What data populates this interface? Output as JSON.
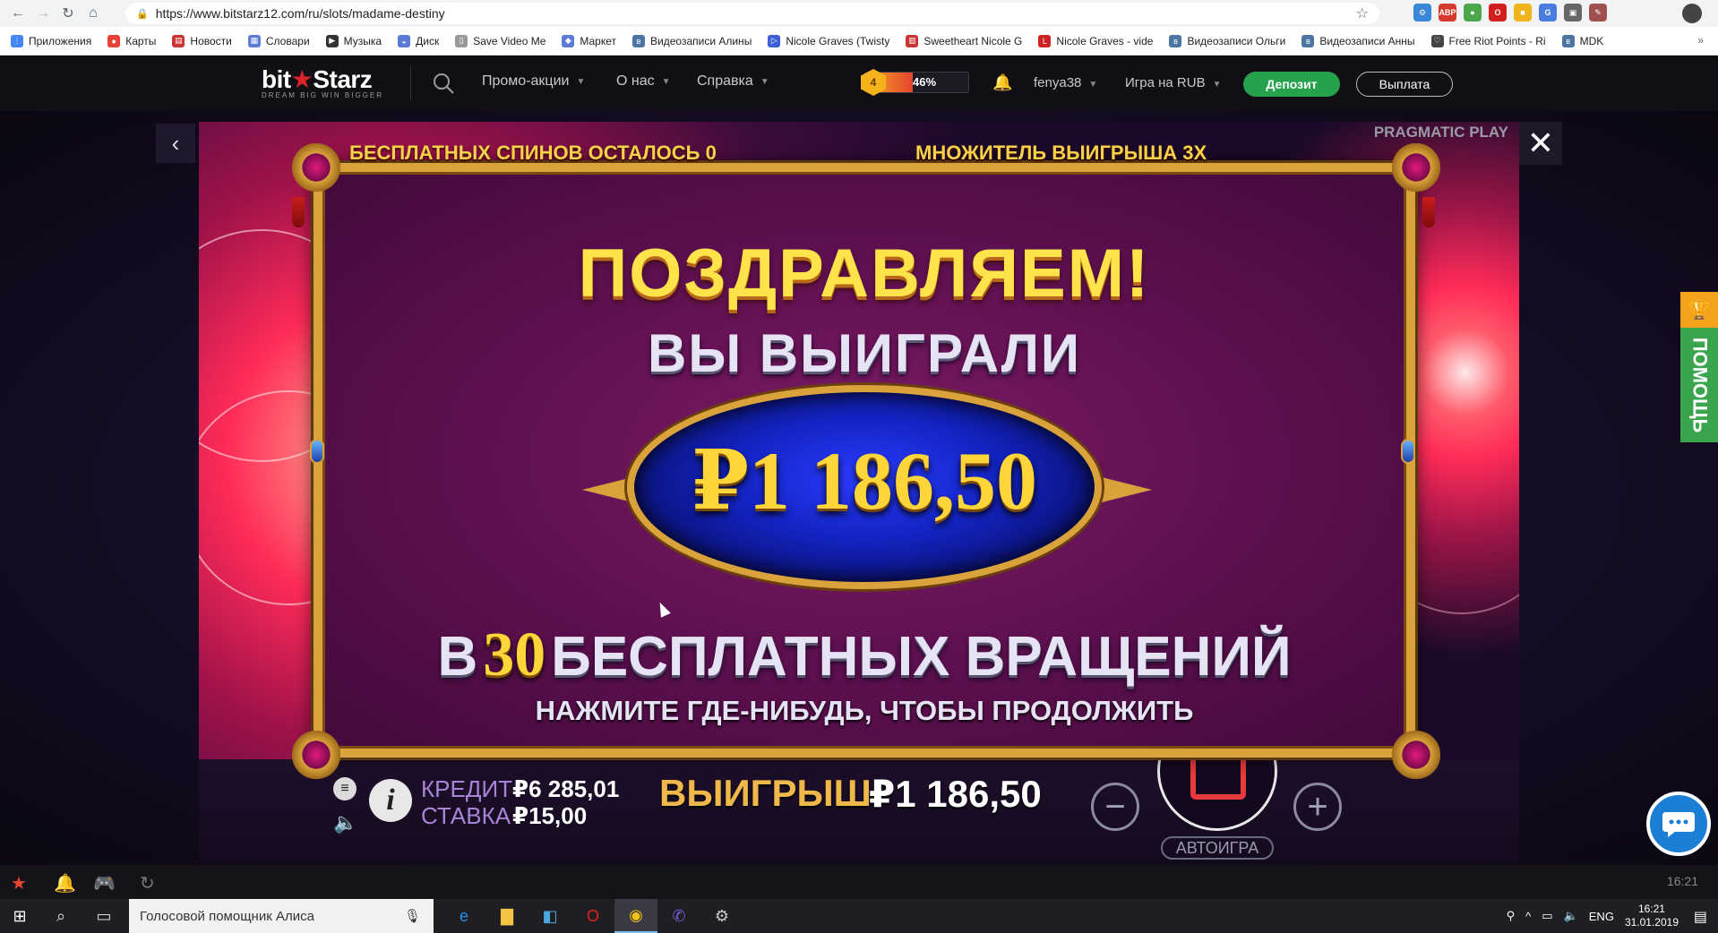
{
  "browser": {
    "url": "https://www.bitstarz12.com/ru/slots/madame-destiny",
    "bookmarks": [
      "Приложения",
      "Карты",
      "Новости",
      "Словари",
      "Музыка",
      "Диск",
      "Save Video Me",
      "Маркет",
      "Видеозаписи Алины",
      "Nicole Graves (Twisty",
      "Sweetheart Nicole G",
      "Nicole Graves - vide",
      "Видеозаписи Ольги",
      "Видеозаписи Анны",
      "Free Riot Points - Ri",
      "MDK"
    ]
  },
  "header": {
    "logo_main": "bit",
    "logo_star": "★",
    "logo_end": "Starz",
    "logo_tagline": "DREAM BIG  WIN BIGGER",
    "menu": [
      "Промо-акции",
      "О нас",
      "Справка"
    ],
    "level_badge": "4",
    "level_progress": "46%",
    "level_fraction": 0.46,
    "username": "fenya38",
    "currency": "Игра на RUB",
    "deposit_label": "Депозит",
    "withdraw_label": "Выплата"
  },
  "game": {
    "free_spins_left": "БЕСПЛАТНЫХ СПИНОВ ОСТАЛОСЬ  0",
    "multiplier": "МНОЖИТЕЛЬ ВЫИГРЫША 3X",
    "provider": "PRAGMATIC PLAY",
    "congrats": "ПОЗДРАВЛЯЕМ!",
    "you_won": "ВЫ ВЫИГРАЛИ",
    "win_amount": "₽1  186,50",
    "spins_prefix": "В",
    "spins_count": "30",
    "spins_suffix": "БЕСПЛАТНЫХ ВРАЩЕНИЙ",
    "continue_hint": "НАЖМИТЕ ГДЕ-НИБУДЬ, ЧТОБЫ ПРОДОЛЖИТЬ",
    "credit_label": "КРЕДИТ",
    "credit_value": "₽6 285,01",
    "bet_label": "СТАВКА",
    "bet_value": "₽15,00",
    "win_label": "ВЫИГРЫШ",
    "win_value": "₽1 186,50",
    "autoplay_label": "АВТОИГРА"
  },
  "sidebar": {
    "help_label": "ПОМОЩЬ"
  },
  "footer": {
    "time": "16:21"
  },
  "taskbar": {
    "search_text": "Голосовой помощник Алиса",
    "lang": "ENG",
    "time": "16:21",
    "date": "31.01.2019"
  },
  "colors": {
    "accent_green": "#27a24c",
    "gold": "#ffd63a",
    "help_green": "#3aa54d",
    "chat_blue": "#1b7fd6"
  }
}
